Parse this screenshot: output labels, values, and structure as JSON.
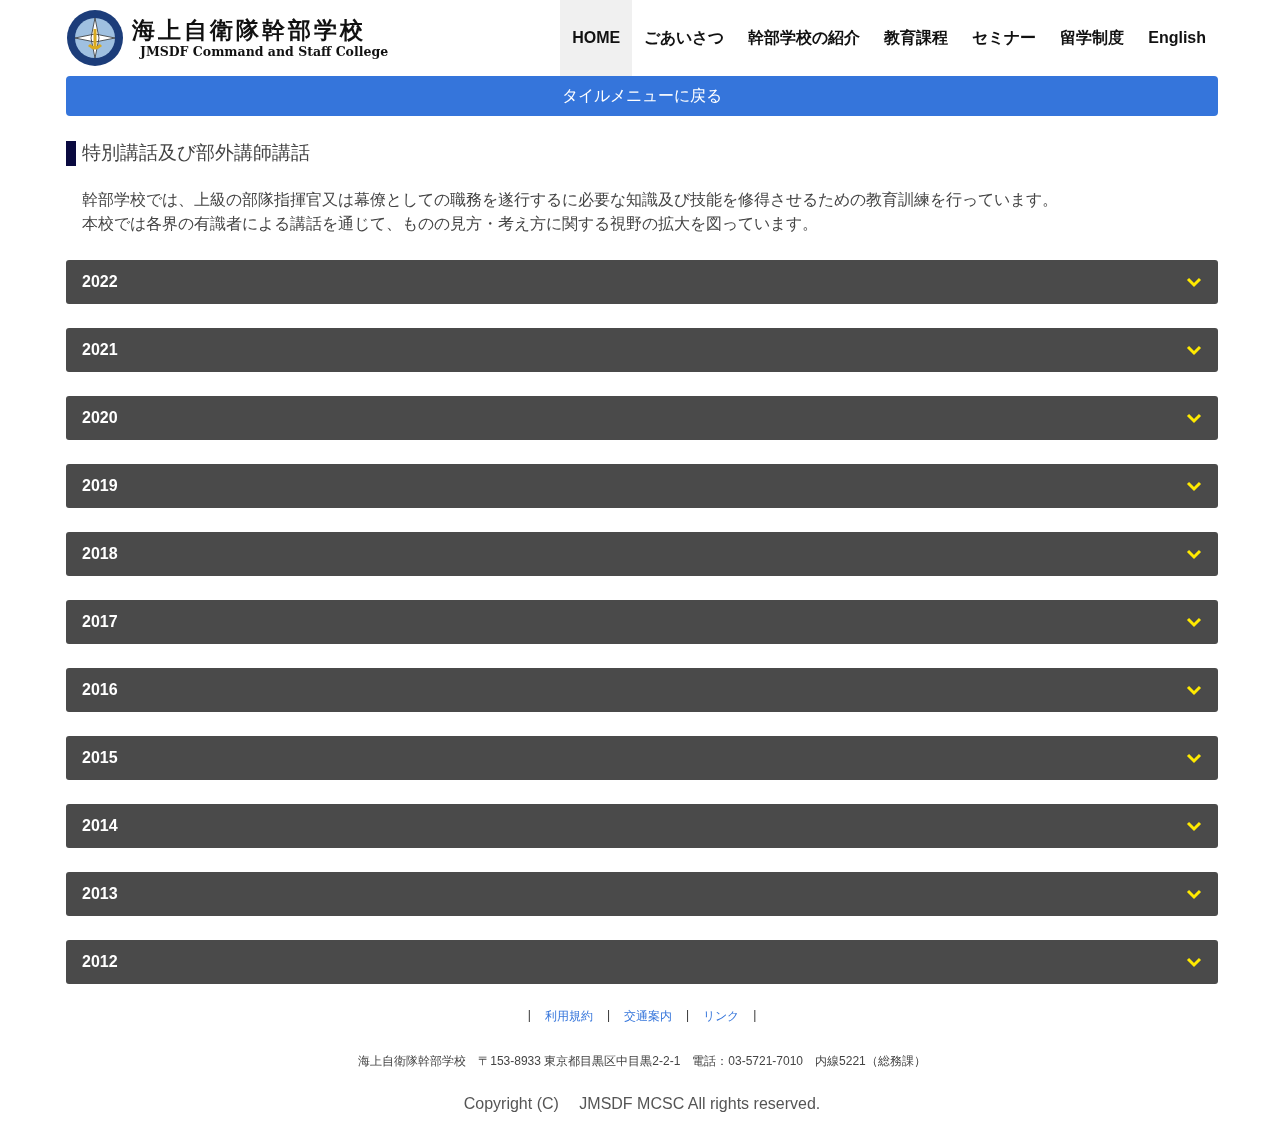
{
  "logo": {
    "title": "海上自衛隊幹部学校",
    "subtitle": "JMSDF Command and Staff College"
  },
  "nav": [
    {
      "label": "HOME",
      "selected": true
    },
    {
      "label": "ごあいさつ",
      "selected": false
    },
    {
      "label": "幹部学校の紹介",
      "selected": false
    },
    {
      "label": "教育課程",
      "selected": false
    },
    {
      "label": "セミナー",
      "selected": false
    },
    {
      "label": "留学制度",
      "selected": false
    },
    {
      "label": "English",
      "selected": false
    }
  ],
  "back_button": "タイルメニューに戻る",
  "heading": "特別講話及び部外講師講話",
  "intro": [
    "幹部学校では、上級の部隊指揮官又は幕僚としての職務を遂行するに必要な知識及び技能を修得させるための教育訓練を行っています。",
    "本校では各界の有識者による講話を通じて、ものの見方・考え方に関する視野の拡大を図っています。"
  ],
  "accordion": [
    {
      "label": "2022",
      "expanded": false
    },
    {
      "label": "2021",
      "expanded": false
    },
    {
      "label": "2020",
      "expanded": false
    },
    {
      "label": "2019",
      "expanded": false
    },
    {
      "label": "2018",
      "expanded": false
    },
    {
      "label": "2017",
      "expanded": false
    },
    {
      "label": "2016",
      "expanded": false
    },
    {
      "label": "2015",
      "expanded": false
    },
    {
      "label": "2014",
      "expanded": false
    },
    {
      "label": "2013",
      "expanded": false
    },
    {
      "label": "2012",
      "expanded": false
    }
  ],
  "footer": {
    "separator": "|",
    "links": [
      "利用規約",
      "交通案内",
      "リンク"
    ],
    "address": "海上自衛隊幹部学校　〒153-8933 東京都目黒区中目黒2-2-1　電話：03-5721-7010　内線5221（総務課）",
    "copyright": "Copyright (C)　 JMSDF MCSC All rights reserved."
  }
}
